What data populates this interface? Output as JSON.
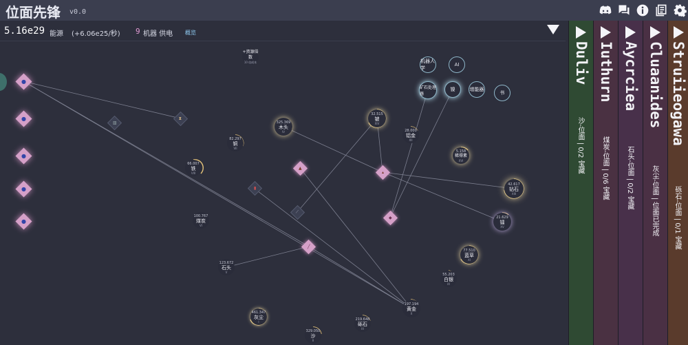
{
  "app": {
    "title": "位面先锋",
    "version": "v0.0"
  },
  "stats": {
    "energy_value": "5.16e29",
    "energy_label": "能源",
    "energy_rate": "(+6.06e25/秒)",
    "machine_count": "9",
    "machine_label": "机器 供电",
    "overview_label": "概览"
  },
  "top_icons": [
    "discord-icon",
    "chat-icon",
    "info-icon",
    "changelog-icon",
    "settings-icon"
  ],
  "tech_nodes": [
    {
      "name": "机器人学"
    },
    {
      "name": "AI"
    },
    {
      "name": "矿石处理器"
    },
    {
      "name": "镍"
    },
    {
      "name": "增能器"
    },
    {
      "name": "书"
    }
  ],
  "resource_nodes": [
    {
      "value": "",
      "name": "+资源倍数",
      "level": "10 倍成本"
    },
    {
      "value": "325.369",
      "name": "木头",
      "level": "IV"
    },
    {
      "value": "32.515",
      "name": "铍",
      "level": "XIV"
    },
    {
      "value": "28.000",
      "name": "铝金",
      "level": "XII"
    },
    {
      "value": "82.297",
      "name": "铜",
      "level": "VII"
    },
    {
      "value": "5.158",
      "name": "稀得素",
      "level": "XVI"
    },
    {
      "value": "66.007",
      "name": "铁",
      "level": "VIII"
    },
    {
      "value": "42.617",
      "name": "钻石",
      "level": "XIII"
    },
    {
      "value": "21.629",
      "name": "镭",
      "level": "XV"
    },
    {
      "value": "100.767",
      "name": "煤炭",
      "level": "VI"
    },
    {
      "value": "77.510",
      "name": "蓝草",
      "level": "XI"
    },
    {
      "value": "123.672",
      "name": "石头",
      "level": "V"
    },
    {
      "value": "55.203",
      "name": "白银",
      "level": "IX"
    },
    {
      "value": "197.194",
      "name": "黄金",
      "level": "X"
    },
    {
      "value": "461.347",
      "name": "灰尘",
      "level": "I"
    },
    {
      "value": "219.648",
      "name": "砾石",
      "level": "III"
    },
    {
      "value": "329.050",
      "name": "沙",
      "level": "II"
    }
  ],
  "planets": [
    {
      "name": "Duliv",
      "subtitle": "沙-位面 | 0/2 宝藏",
      "color": "#2f4a33"
    },
    {
      "name": "Iuthurn",
      "subtitle": "煤炭-位面 | 0/6 宝藏",
      "color": "#4a3142"
    },
    {
      "name": "Aycrciea",
      "subtitle": "石头-位面 | 0/2 宝藏",
      "color": "#48304a"
    },
    {
      "name": "Cluaanides",
      "subtitle": "灰尘-位面 | 位面已完成",
      "color": "#4a3044"
    },
    {
      "name": "Struiieogawa",
      "subtitle": "砾石-位面 | 0/1 宝藏",
      "color": "#5a3b2c"
    }
  ],
  "colors": {
    "background": "#2d2f3c",
    "topbar": "#3b3e4f",
    "machine_count": "#e29bd4",
    "overview_link": "#8ec9f0",
    "pink_diamond": "#d5a0c8",
    "node_ring_gold": "#e6c47a",
    "tech_ring": "#8fb7c9"
  }
}
